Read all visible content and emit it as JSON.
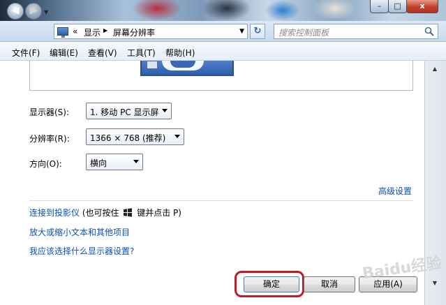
{
  "window": {
    "controls": {
      "minimize": "–",
      "maximize": "□",
      "close": "x"
    }
  },
  "address": {
    "chevrons": "«",
    "crumbs": [
      "显示",
      "屏幕分辨率"
    ],
    "search_placeholder": "搜索控制面板"
  },
  "menu": [
    "文件(F)",
    "编辑(E)",
    "查看(V)",
    "工具(T)",
    "帮助(H)"
  ],
  "settings": {
    "display_label": "显示器(S):",
    "display_value": "1. 移动 PC 显示屏",
    "resolution_label": "分辨率(R):",
    "resolution_value": "1366 × 768 (推荐)",
    "orientation_label": "方向(O):",
    "orientation_value": "横向"
  },
  "links": {
    "advanced": "高级设置",
    "projector": "连接到投影仪",
    "projector_hint_before": "(也可按住",
    "projector_hint_after": "键并点击 P)",
    "text_size": "放大或缩小文本和其他项目",
    "help": "我应该选择什么显示器设置?"
  },
  "buttons": {
    "ok": "确定",
    "cancel": "取消",
    "apply": "应用(A)"
  },
  "watermark": "Baidu经验",
  "colors": {
    "link": "#0a4fb5",
    "highlight_ring": "#c4182c",
    "titlebar": "#7e99b8"
  }
}
